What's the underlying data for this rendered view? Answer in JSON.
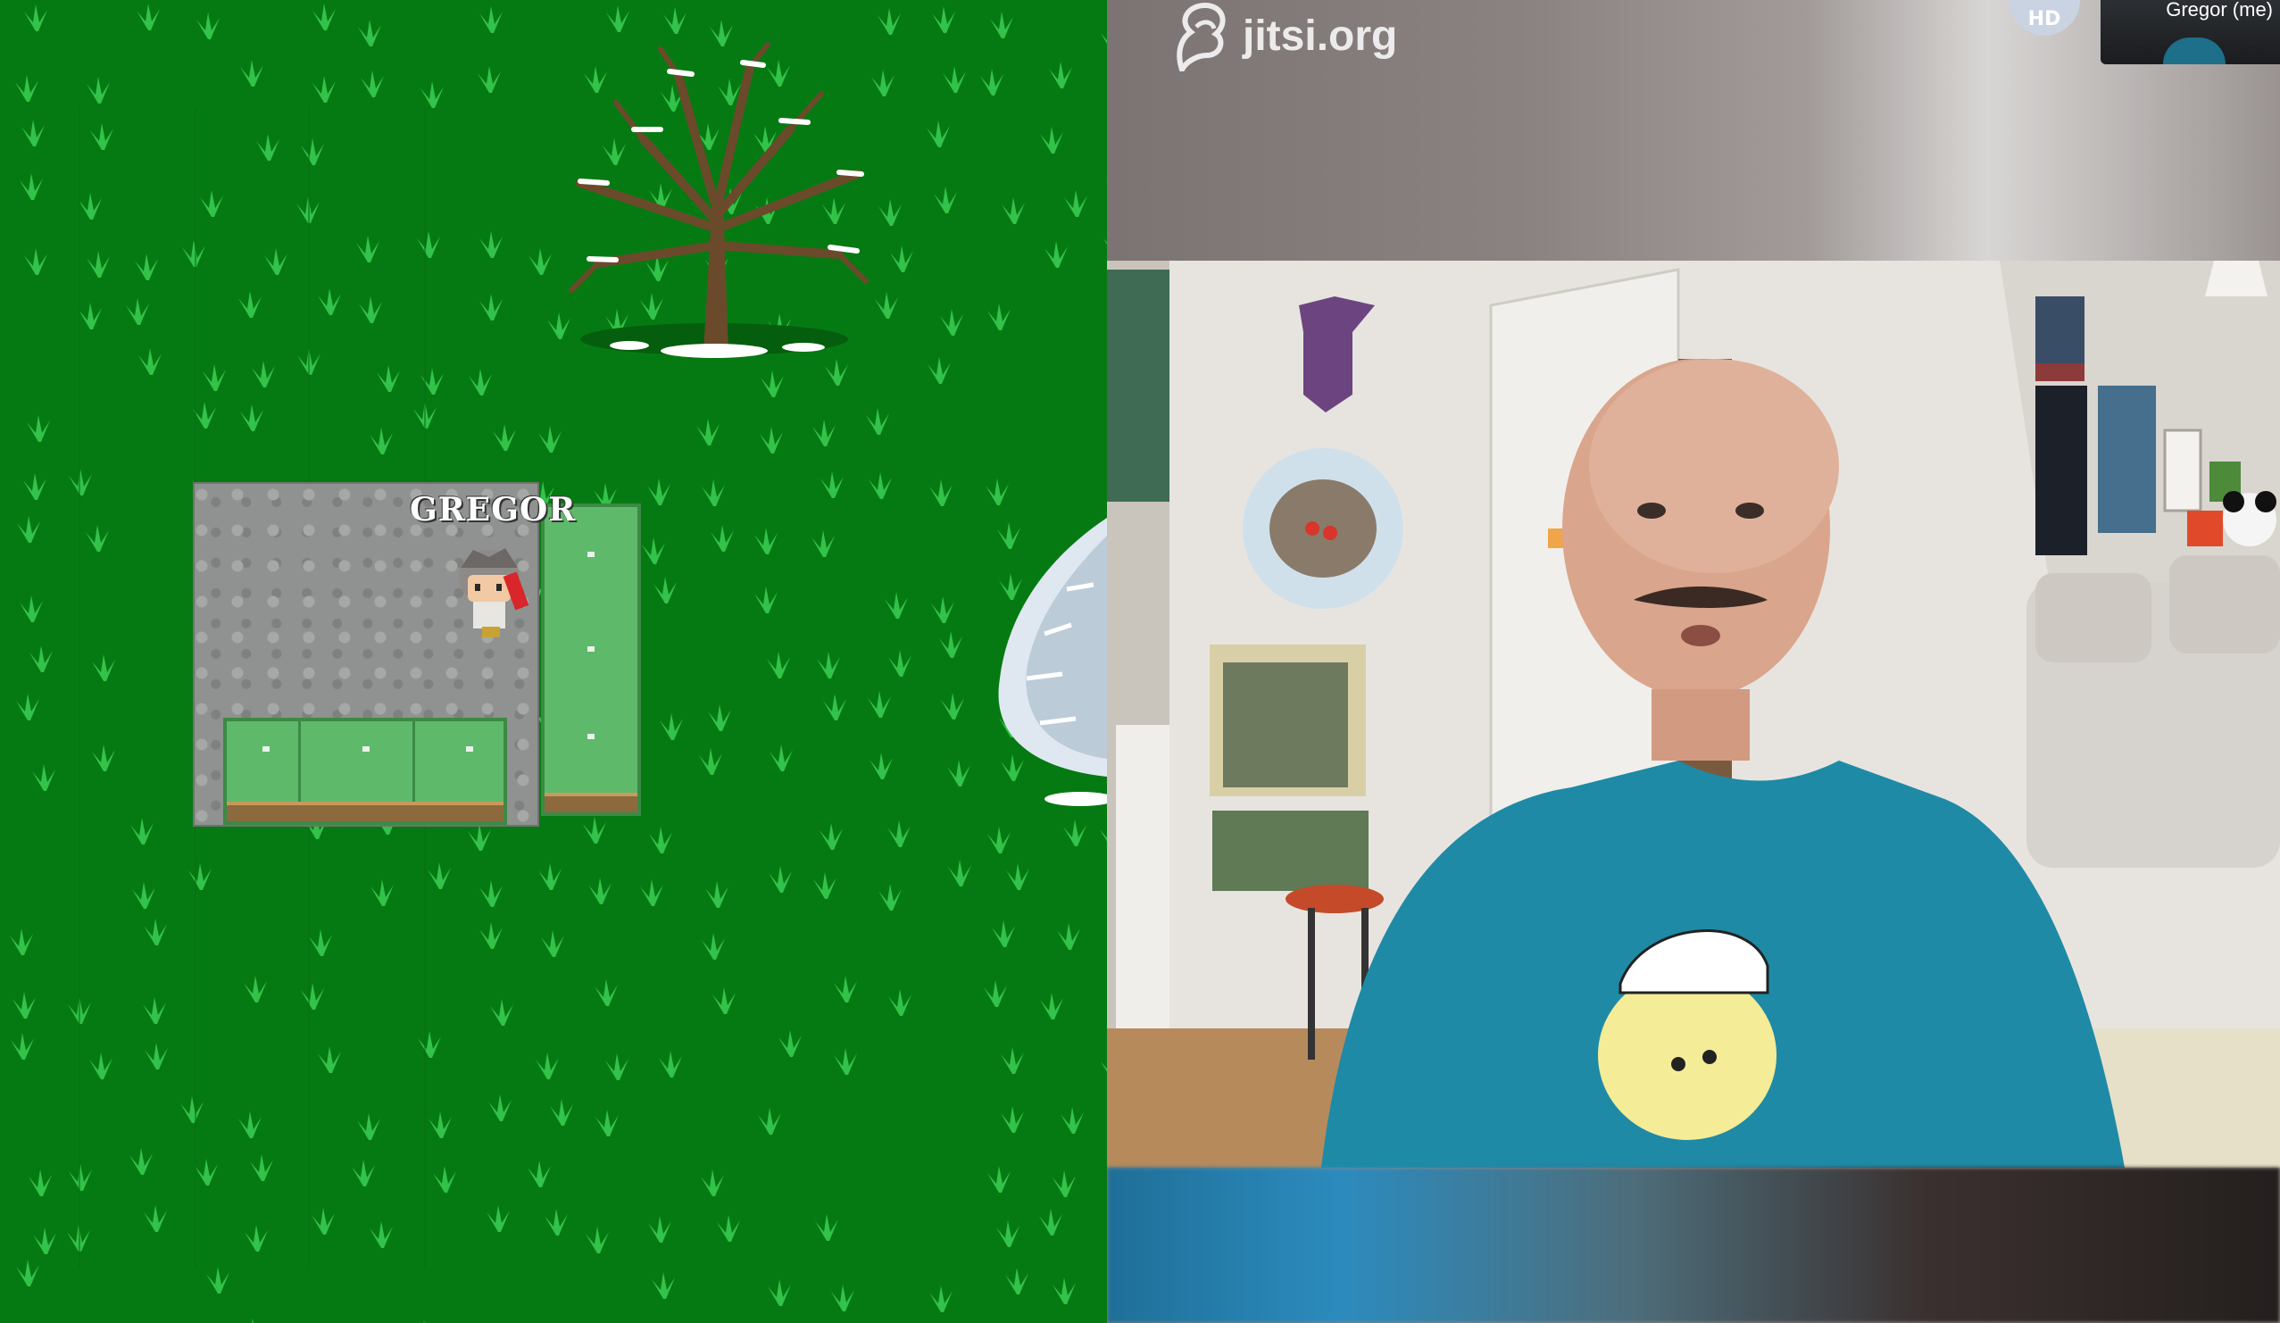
{
  "game": {
    "player_name": "GREGOR"
  },
  "video": {
    "logo_text": "jitsi.org",
    "quality_badge": "HD",
    "self_view_label": "Gregor (me)"
  },
  "colors": {
    "grass": "#067a12",
    "grass_tuft": "#33c24a",
    "shirt": "#1f8aa6"
  }
}
